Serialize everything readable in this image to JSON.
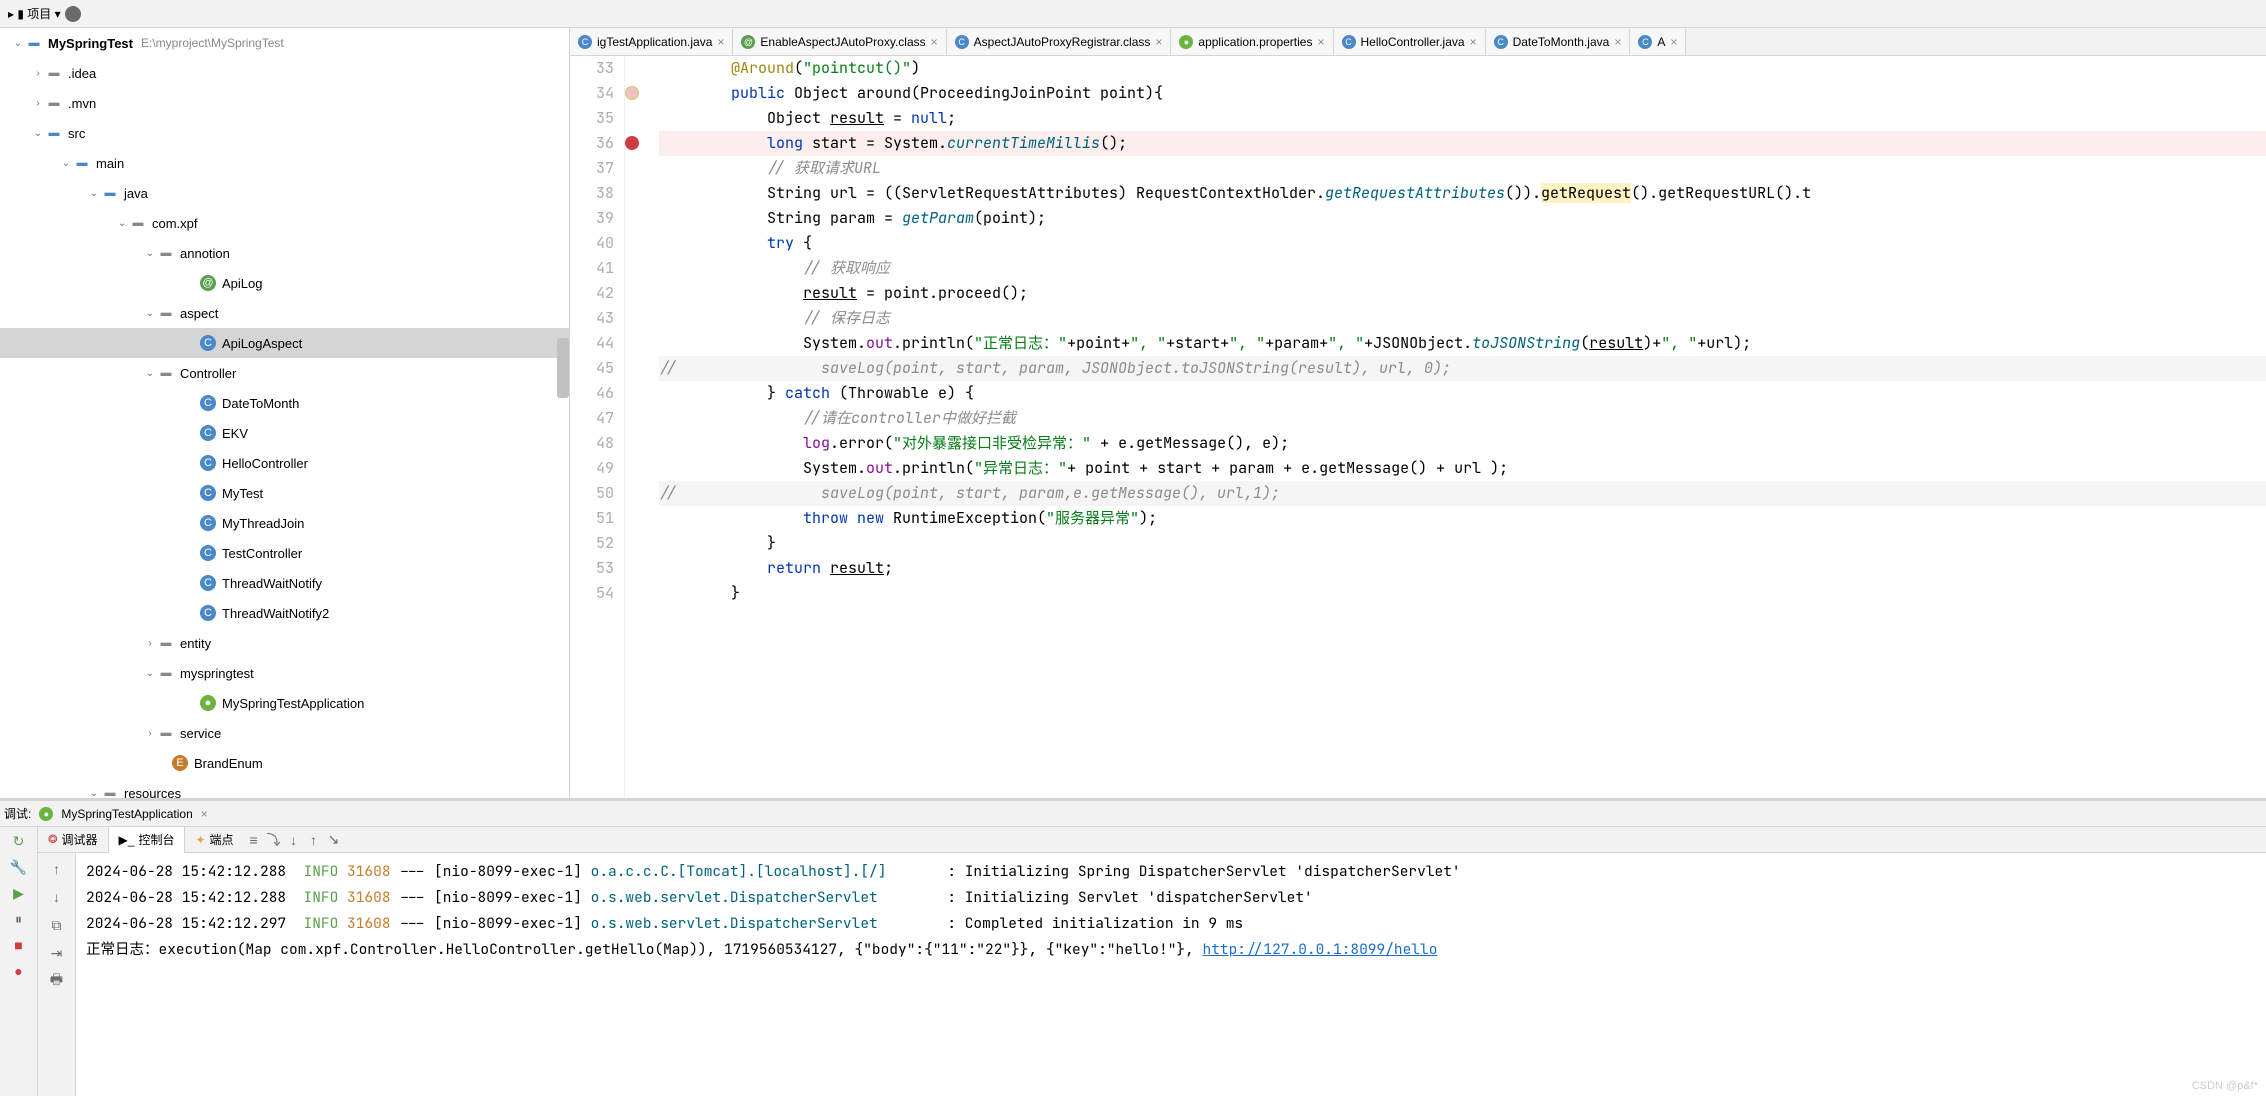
{
  "topbar": {
    "project_word": "项目"
  },
  "tree": {
    "root": "MySpringTest",
    "root_path": "E:\\myproject\\MySpringTest",
    "items": [
      {
        "indent": 30,
        "arrow": "›",
        "icon": "folder",
        "label": ".idea"
      },
      {
        "indent": 30,
        "arrow": "›",
        "icon": "folder",
        "label": ".mvn"
      },
      {
        "indent": 30,
        "arrow": "⌄",
        "icon": "folder-blue",
        "label": "src"
      },
      {
        "indent": 58,
        "arrow": "⌄",
        "icon": "folder-blue",
        "label": "main"
      },
      {
        "indent": 86,
        "arrow": "⌄",
        "icon": "folder-blue",
        "label": "java"
      },
      {
        "indent": 114,
        "arrow": "⌄",
        "icon": "folder",
        "label": "com.xpf"
      },
      {
        "indent": 142,
        "arrow": "⌄",
        "icon": "folder",
        "label": "annotion"
      },
      {
        "indent": 184,
        "arrow": "",
        "icon": "int",
        "label": "ApiLog"
      },
      {
        "indent": 142,
        "arrow": "⌄",
        "icon": "folder",
        "label": "aspect"
      },
      {
        "indent": 184,
        "arrow": "",
        "icon": "class",
        "label": "ApiLogAspect",
        "selected": true
      },
      {
        "indent": 142,
        "arrow": "⌄",
        "icon": "folder",
        "label": "Controller"
      },
      {
        "indent": 184,
        "arrow": "",
        "icon": "class",
        "label": "DateToMonth"
      },
      {
        "indent": 184,
        "arrow": "",
        "icon": "class",
        "label": "EKV"
      },
      {
        "indent": 184,
        "arrow": "",
        "icon": "class",
        "label": "HelloController"
      },
      {
        "indent": 184,
        "arrow": "",
        "icon": "class",
        "label": "MyTest"
      },
      {
        "indent": 184,
        "arrow": "",
        "icon": "class",
        "label": "MyThreadJoin"
      },
      {
        "indent": 184,
        "arrow": "",
        "icon": "class",
        "label": "TestController"
      },
      {
        "indent": 184,
        "arrow": "",
        "icon": "class",
        "label": "ThreadWaitNotify"
      },
      {
        "indent": 184,
        "arrow": "",
        "icon": "class",
        "label": "ThreadWaitNotify2"
      },
      {
        "indent": 142,
        "arrow": "›",
        "icon": "folder",
        "label": "entity"
      },
      {
        "indent": 142,
        "arrow": "⌄",
        "icon": "folder",
        "label": "myspringtest"
      },
      {
        "indent": 184,
        "arrow": "",
        "icon": "spring",
        "label": "MySpringTestApplication"
      },
      {
        "indent": 142,
        "arrow": "›",
        "icon": "folder",
        "label": "service"
      },
      {
        "indent": 156,
        "arrow": "",
        "icon": "enum",
        "label": "BrandEnum"
      },
      {
        "indent": 86,
        "arrow": "⌄",
        "icon": "folder",
        "label": "resources"
      }
    ]
  },
  "tabs": [
    {
      "icon": "class",
      "label": "igTestApplication.java"
    },
    {
      "icon": "int",
      "label": "EnableAspectJAutoProxy.class"
    },
    {
      "icon": "class",
      "label": "AspectJAutoProxyRegistrar.class"
    },
    {
      "icon": "spring",
      "label": "application.properties"
    },
    {
      "icon": "class",
      "label": "HelloController.java"
    },
    {
      "icon": "class",
      "label": "DateToMonth.java"
    },
    {
      "icon": "class",
      "label": "A"
    }
  ],
  "lines": {
    "start": 33,
    "rows": [
      {
        "n": 33,
        "html": "        <span class='ann'>@Around</span>(<span class='str'>\"pointcut()\"</span>)"
      },
      {
        "n": 34,
        "gut": "m",
        "html": "        <span class='kw'>public</span> Object around(ProceedingJoinPoint point){"
      },
      {
        "n": 35,
        "html": "            Object <span class='ul'>result</span> = <span class='kw'>null</span>;"
      },
      {
        "n": 36,
        "cls": "hl-pink",
        "gut": "bp",
        "html": "            <span class='kw'>long</span> start = System.<span class='mth'>currentTimeMillis</span>();"
      },
      {
        "n": 37,
        "html": "            <span class='cmt'>// 获取请求URL</span>"
      },
      {
        "n": 38,
        "html": "            String url = ((ServletRequestAttributes) RequestContextHolder.<span class='mth'>getRequestAttributes</span>()).<span class='hl-y'>getRequest</span>().getRequestURL().t"
      },
      {
        "n": 39,
        "html": "            String param = <span class='mth'>getParam</span>(point);"
      },
      {
        "n": 40,
        "html": "            <span class='kw'>try</span> {"
      },
      {
        "n": 41,
        "html": "                <span class='cmt'>// 获取响应</span>"
      },
      {
        "n": 42,
        "html": "                <span class='ul'>result</span> = point.proceed();"
      },
      {
        "n": 43,
        "html": "                <span class='cmt'>// 保存日志</span>"
      },
      {
        "n": 44,
        "html": "                System.<span class='fld'>out</span>.println(<span class='str'>\"正常日志：\"</span>+point+<span class='str'>\", \"</span>+start+<span class='str'>\", \"</span>+param+<span class='str'>\", \"</span>+JSONObject.<span class='mth'>toJSONString</span>(<span class='ul'>result</span>)+<span class='str'>\", \"</span>+url);"
      },
      {
        "n": 45,
        "cls": "hl-grey",
        "html": "<span class='cmt'>//                saveLog(point, start, param, JSONObject.toJSONString(result), url, 0);</span>"
      },
      {
        "n": 46,
        "html": "            } <span class='kw'>catch</span> (Throwable e) {"
      },
      {
        "n": 47,
        "html": "                <span class='cmt'>//请在controller中做好拦截</span>"
      },
      {
        "n": 48,
        "html": "                <span class='fld'>log</span>.error(<span class='str'>\"对外暴露接口非受检异常：\"</span> + e.getMessage(), e);"
      },
      {
        "n": 49,
        "html": "                System.<span class='fld'>out</span>.println(<span class='str'>\"异常日志：\"</span>+ point + start + param + e.getMessage() + url );"
      },
      {
        "n": 50,
        "cls": "hl-grey",
        "html": "<span class='cmt'>//                saveLog(point, start, param,e.getMessage(), url,1);</span>"
      },
      {
        "n": 51,
        "html": "                <span class='kw'>throw new</span> RuntimeException(<span class='str'>\"服务器异常\"</span>);"
      },
      {
        "n": 52,
        "html": "            }"
      },
      {
        "n": 53,
        "html": "            <span class='kw'>return</span> <span class='ul'>result</span>;"
      },
      {
        "n": 54,
        "html": "        }"
      }
    ]
  },
  "debug": {
    "title": "调试:",
    "run_config": "MySpringTestApplication",
    "sub_tabs": {
      "debugger": "调试器",
      "console": "控制台",
      "breakpoints": "端点"
    },
    "console_lines": [
      {
        "ts": "2024-06-28 15:42:12.288",
        "lvl": "INFO",
        "pid": "31608",
        "thread": "[nio-8099-exec-1]",
        "cls": "o.a.c.c.C.[Tomcat].[localhost].[/]     ",
        "msg": ": Initializing Spring DispatcherServlet 'dispatcherServlet'"
      },
      {
        "ts": "2024-06-28 15:42:12.288",
        "lvl": "INFO",
        "pid": "31608",
        "thread": "[nio-8099-exec-1]",
        "cls": "o.s.web.servlet.DispatcherServlet      ",
        "msg": ": Initializing Servlet 'dispatcherServlet'"
      },
      {
        "ts": "2024-06-28 15:42:12.297",
        "lvl": "INFO",
        "pid": "31608",
        "thread": "[nio-8099-exec-1]",
        "cls": "o.s.web.servlet.DispatcherServlet      ",
        "msg": ": Completed initialization in 9 ms"
      }
    ],
    "output_line_prefix": "正常日志：execution(Map com.xpf.Controller.HelloController.getHello(Map)), 1719560534127, {\"body\":{\"11\":\"22\"}}, {\"key\":\"hello!\"}, ",
    "output_link": "http://127.0.0.1:8099/hello"
  },
  "watermark": "CSDN @p&f*"
}
